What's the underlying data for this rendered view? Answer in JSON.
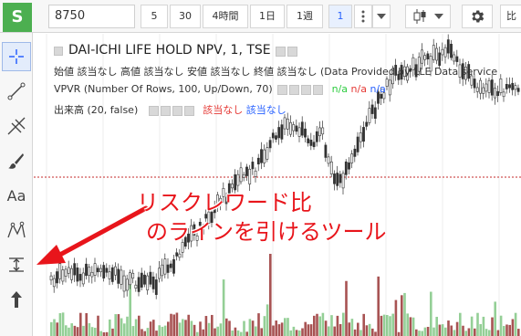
{
  "app": {
    "logo_letter": "S",
    "symbol_value": "8750"
  },
  "toolbar": {
    "intervals": [
      "5",
      "30",
      "4時間",
      "1日",
      "1週",
      "1"
    ],
    "active_interval": "1",
    "compare_label": "比"
  },
  "legend": {
    "title": "DAI-ICHI LIFE HOLD NPV, 1, TSE",
    "ohlc_line": "始値 該当なし 高値 該当なし 安値 該当なし 終値 該当なし (Data Provided by LLE Data service",
    "vpvr_label": "VPVR (Number Of Rows, 100, Up/Down, 70)",
    "vpvr_na_1": "n/a",
    "vpvr_na_2": "n/a",
    "vpvr_na_3": "n/a",
    "volume_label": "出来高 (20, false)",
    "volume_na_1": "該当なし",
    "volume_na_2": "該当なし"
  },
  "annotation": {
    "line1": "リスクレワード比",
    "line2": "のラインを引けるツール"
  },
  "colors": {
    "up": "#4caf50",
    "down": "#8b1a1a",
    "annotation": "#e8151b",
    "accent": "#2962ff"
  },
  "icons": {
    "tools": [
      "crosshair-icon",
      "trend-line-icon",
      "pitchfork-icon",
      "brush-icon",
      "text-icon",
      "pattern-icon",
      "measure-icon",
      "arrow-up-icon"
    ],
    "toolbar": [
      "more-vertical-icon",
      "chevron-down-icon",
      "candlestick-icon",
      "settings-gear-icon"
    ]
  }
}
